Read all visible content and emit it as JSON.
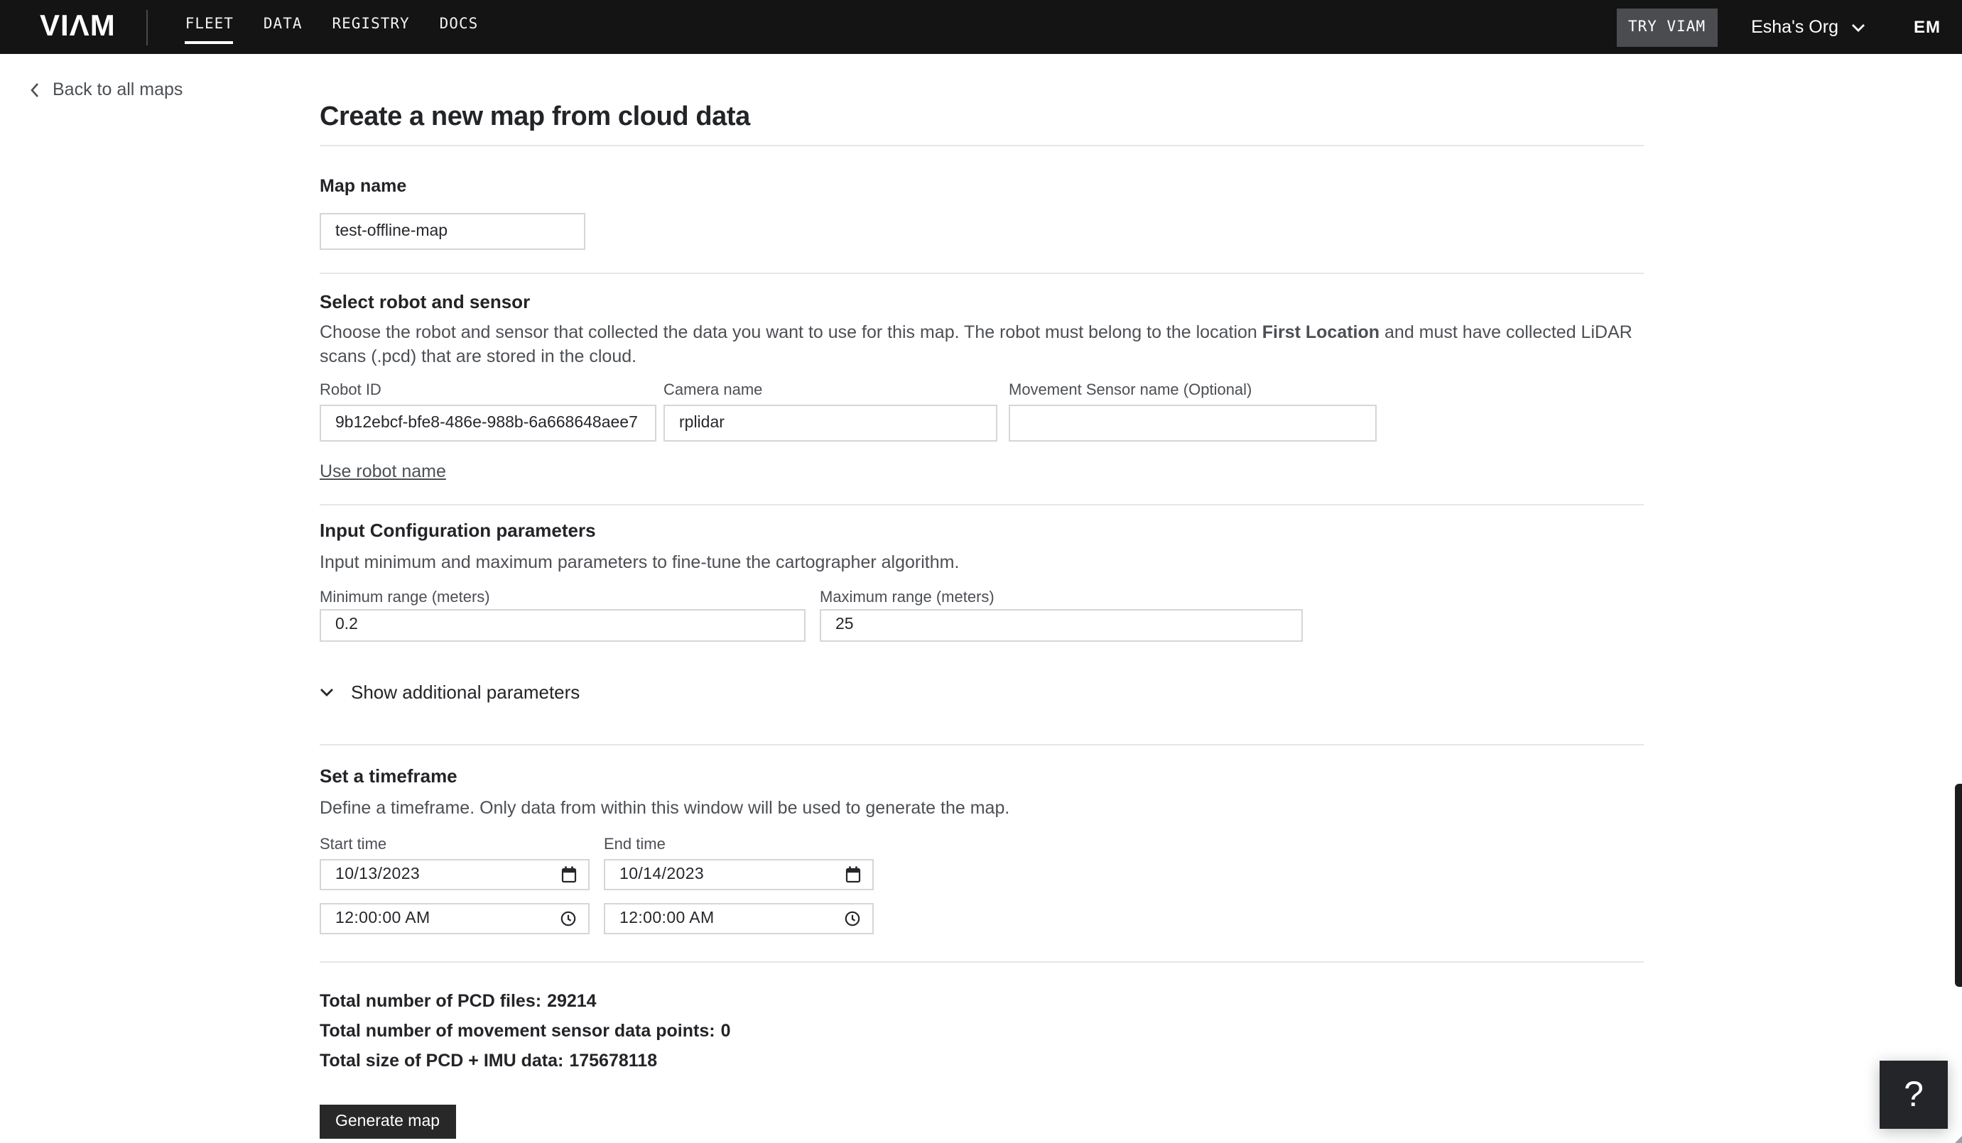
{
  "colors": {
    "nav_bg": "#141415",
    "try_viam_bg": "#4b4c4f",
    "generate_btn_bg": "#282829",
    "help_fab_bg": "#232528",
    "input_border": "#d6d6d8",
    "divider": "#e6e6e8",
    "heading_text": "#232427",
    "body_text": "#4c4f54"
  },
  "nav": {
    "logo": "VIΛM",
    "links": [
      {
        "label": "FLEET"
      },
      {
        "label": "DATA"
      },
      {
        "label": "REGISTRY"
      },
      {
        "label": "DOCS"
      }
    ],
    "active_link": "FLEET",
    "try_viam_label": "TRY VIAM",
    "org_name": "Esha's Org",
    "avatar_initials": "EM"
  },
  "back_link": {
    "label": "Back to all maps"
  },
  "page": {
    "title": "Create a new map from cloud data"
  },
  "map_name": {
    "label": "Map name",
    "value": "test-offline-map"
  },
  "robot_section": {
    "heading": "Select robot and sensor",
    "description_before": "Choose the robot and sensor that collected the data you want to use for this map. The robot must belong to the location ",
    "location_name": "First Location",
    "description_after": " and must have collected LiDAR scans (.pcd) that are stored in the cloud.",
    "robot_id": {
      "label": "Robot ID",
      "value": "9b12ebcf-bfe8-486e-988b-6a668648aee7"
    },
    "camera": {
      "label": "Camera name",
      "value": "rplidar"
    },
    "movement_sensor": {
      "label": "Movement Sensor name (Optional)",
      "value": ""
    },
    "use_robot_name_label": "Use robot name"
  },
  "config_section": {
    "heading": "Input Configuration parameters",
    "description": "Input minimum and maximum parameters to fine-tune the cartographer algorithm.",
    "min_range": {
      "label": "Minimum range (meters)",
      "value": "0.2"
    },
    "max_range": {
      "label": "Maximum range (meters)",
      "value": "25"
    },
    "show_additional_label": "Show additional parameters"
  },
  "timeframe_section": {
    "heading": "Set a timeframe",
    "description": "Define a timeframe. Only data from within this window will be used to generate the map.",
    "start_label": "Start time",
    "end_label": "End time",
    "start_date": "10/13/2023",
    "end_date": "10/14/2023",
    "start_time": "12:00:00 AM",
    "end_time": "12:00:00 AM"
  },
  "summary": {
    "lines": [
      {
        "label": "Total number of PCD files:",
        "value": "29214"
      },
      {
        "label": "Total number of movement sensor data points:",
        "value": "0"
      },
      {
        "label": "Total size of PCD + IMU data:",
        "value": "175678118"
      }
    ]
  },
  "generate_button_label": "Generate map",
  "help_button_label": "?"
}
